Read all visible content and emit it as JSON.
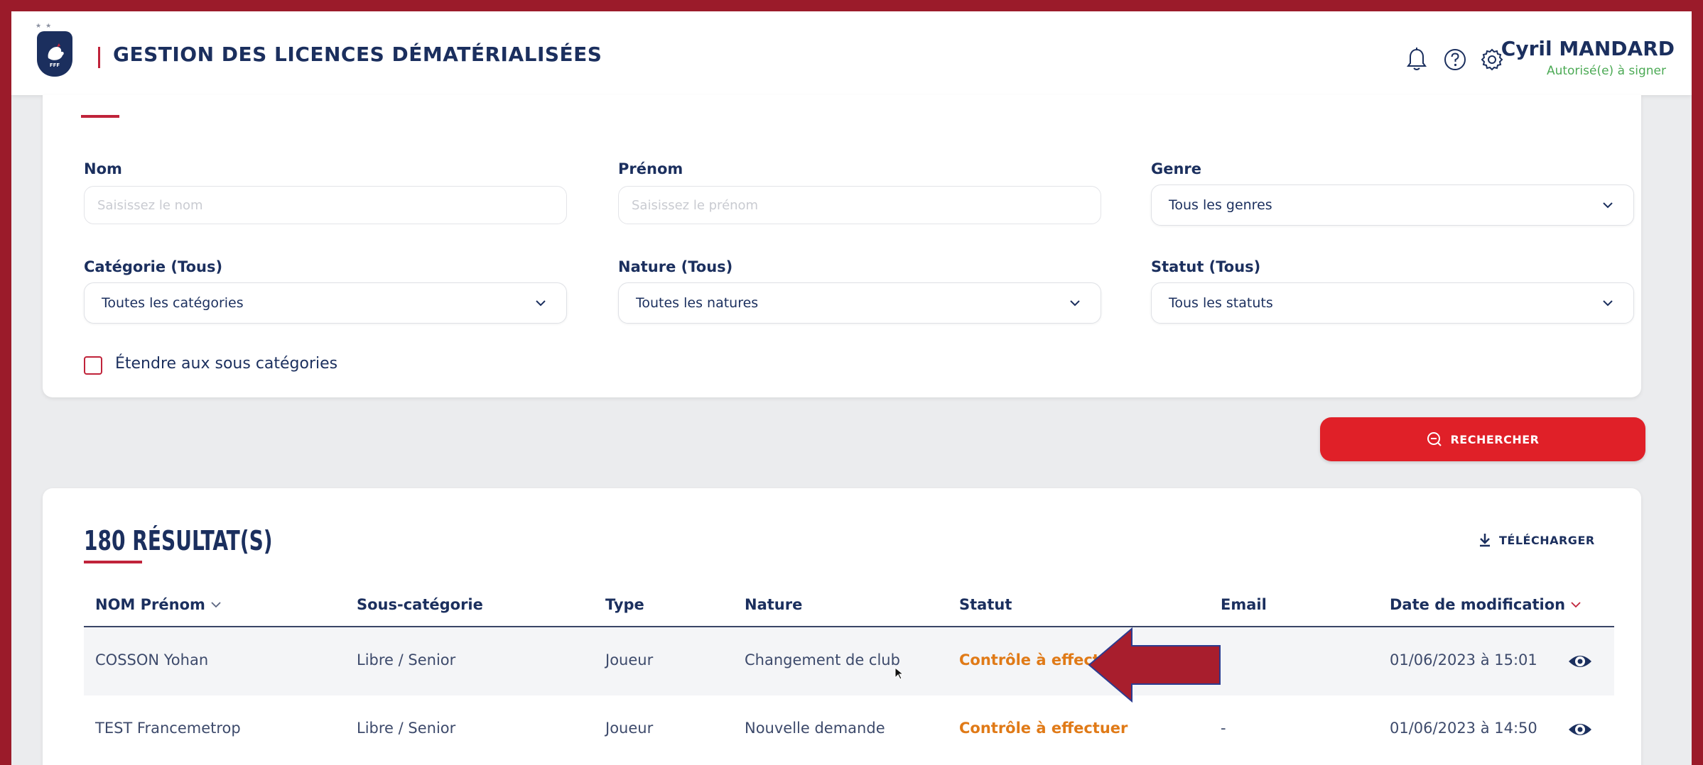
{
  "header": {
    "app_title": "GESTION DES LICENCES DÉMATÉRIALISÉES",
    "logo_text": "FFF",
    "stars": "★★",
    "user_name": "Cyril MANDARD",
    "user_role": "Autorisé(e) à signer",
    "icons": [
      "bell-icon",
      "help-icon",
      "gear-icon"
    ]
  },
  "filters": {
    "nom": {
      "label": "Nom",
      "placeholder": "Saisissez le nom"
    },
    "prenom": {
      "label": "Prénom",
      "placeholder": "Saisissez le prénom"
    },
    "genre": {
      "label": "Genre",
      "value": "Tous les genres"
    },
    "categorie": {
      "label": "Catégorie (Tous)",
      "value": "Toutes les catégories"
    },
    "nature": {
      "label": "Nature (Tous)",
      "value": "Toutes les natures"
    },
    "statut": {
      "label": "Statut (Tous)",
      "value": "Tous les statuts"
    },
    "extend_label": "Étendre aux sous catégories",
    "search_label": "RECHERCHER"
  },
  "results": {
    "title": "180 RÉSULTAT(S)",
    "download_label": "TÉLÉCHARGER",
    "columns": [
      "NOM Prénom",
      "Sous-catégorie",
      "Type",
      "Nature",
      "Statut",
      "Email",
      "Date de modification"
    ],
    "rows": [
      {
        "name": "COSSON Yohan",
        "subcat": "Libre / Senior",
        "type": "Joueur",
        "nature": "Changement de club",
        "status": "Contrôle à effectuer",
        "email": "",
        "date": "01/06/2023 à 15:01"
      },
      {
        "name": "TEST Francemetrop",
        "subcat": "Libre / Senior",
        "type": "Joueur",
        "nature": "Nouvelle demande",
        "status": "Contrôle à effectuer",
        "email": "-",
        "date": "01/06/2023 à 14:50"
      }
    ]
  },
  "colors": {
    "frame": "#9b1b2a",
    "navy": "#1b2f5e",
    "accent_red": "#e02028",
    "status_orange": "#e07a17",
    "role_green": "#4caa55"
  }
}
